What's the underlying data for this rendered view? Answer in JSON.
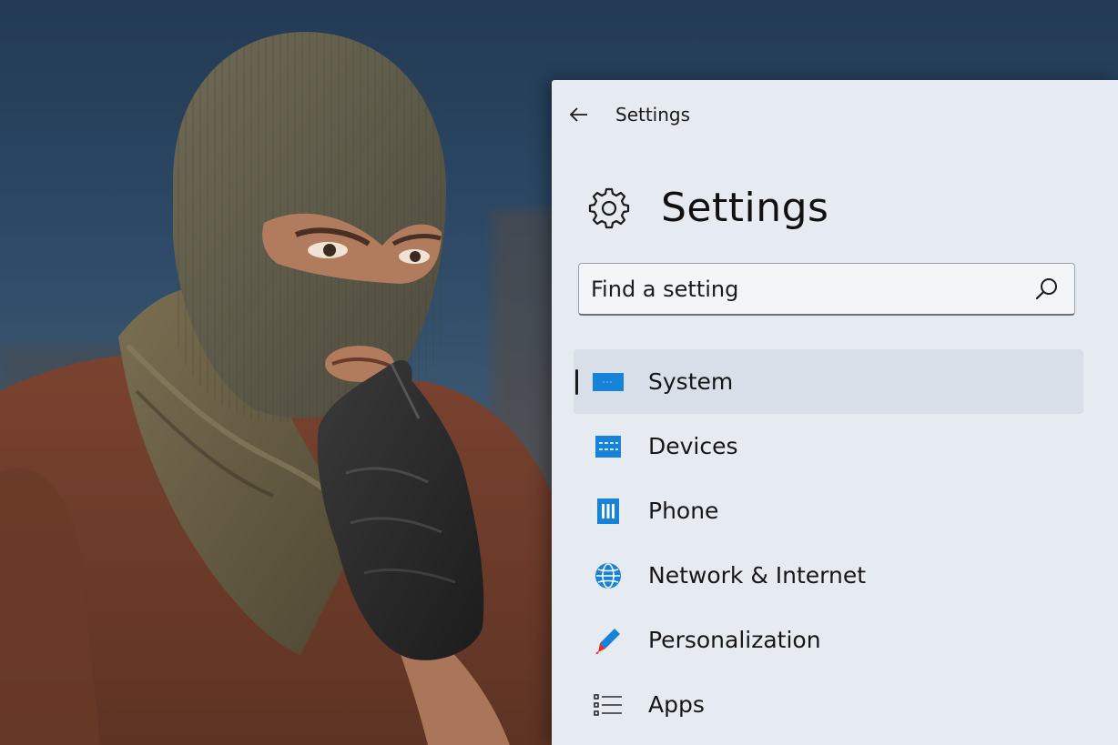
{
  "window": {
    "title": "Settings"
  },
  "header": {
    "title": "Settings"
  },
  "search": {
    "placeholder": "Find a setting"
  },
  "nav": {
    "items": [
      {
        "label": "System",
        "icon": "system-icon",
        "selected": true
      },
      {
        "label": "Devices",
        "icon": "devices-icon",
        "selected": false
      },
      {
        "label": "Phone",
        "icon": "phone-icon",
        "selected": false
      },
      {
        "label": "Network & Internet",
        "icon": "globe-icon",
        "selected": false
      },
      {
        "label": "Personalization",
        "icon": "pen-icon",
        "selected": false
      },
      {
        "label": "Apps",
        "icon": "apps-list-icon",
        "selected": false
      }
    ]
  },
  "colors": {
    "accent": "#1683d8",
    "window_bg": "#e6ebf1",
    "selected_bg": "#d8dfe8"
  }
}
